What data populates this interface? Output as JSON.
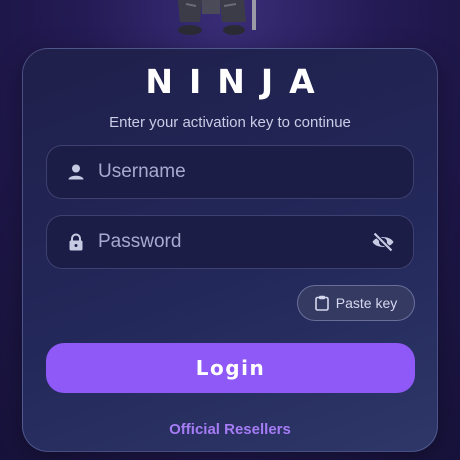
{
  "app": {
    "title": "NINJA",
    "subtitle": "Enter your activation key to continue"
  },
  "username": {
    "placeholder": "Username",
    "value": "",
    "icon": "user-icon"
  },
  "password": {
    "placeholder": "Password",
    "value": "",
    "icon": "lock-icon",
    "visibility_icon": "eye-off-icon"
  },
  "paste": {
    "label": "Paste key",
    "icon": "clipboard-icon"
  },
  "login": {
    "label": "Login"
  },
  "resellers_link": {
    "label": "Official Resellers"
  },
  "colors": {
    "accent": "#8f59f7",
    "link": "#a57cf5",
    "background": "#241b55",
    "card": "#23285a"
  }
}
